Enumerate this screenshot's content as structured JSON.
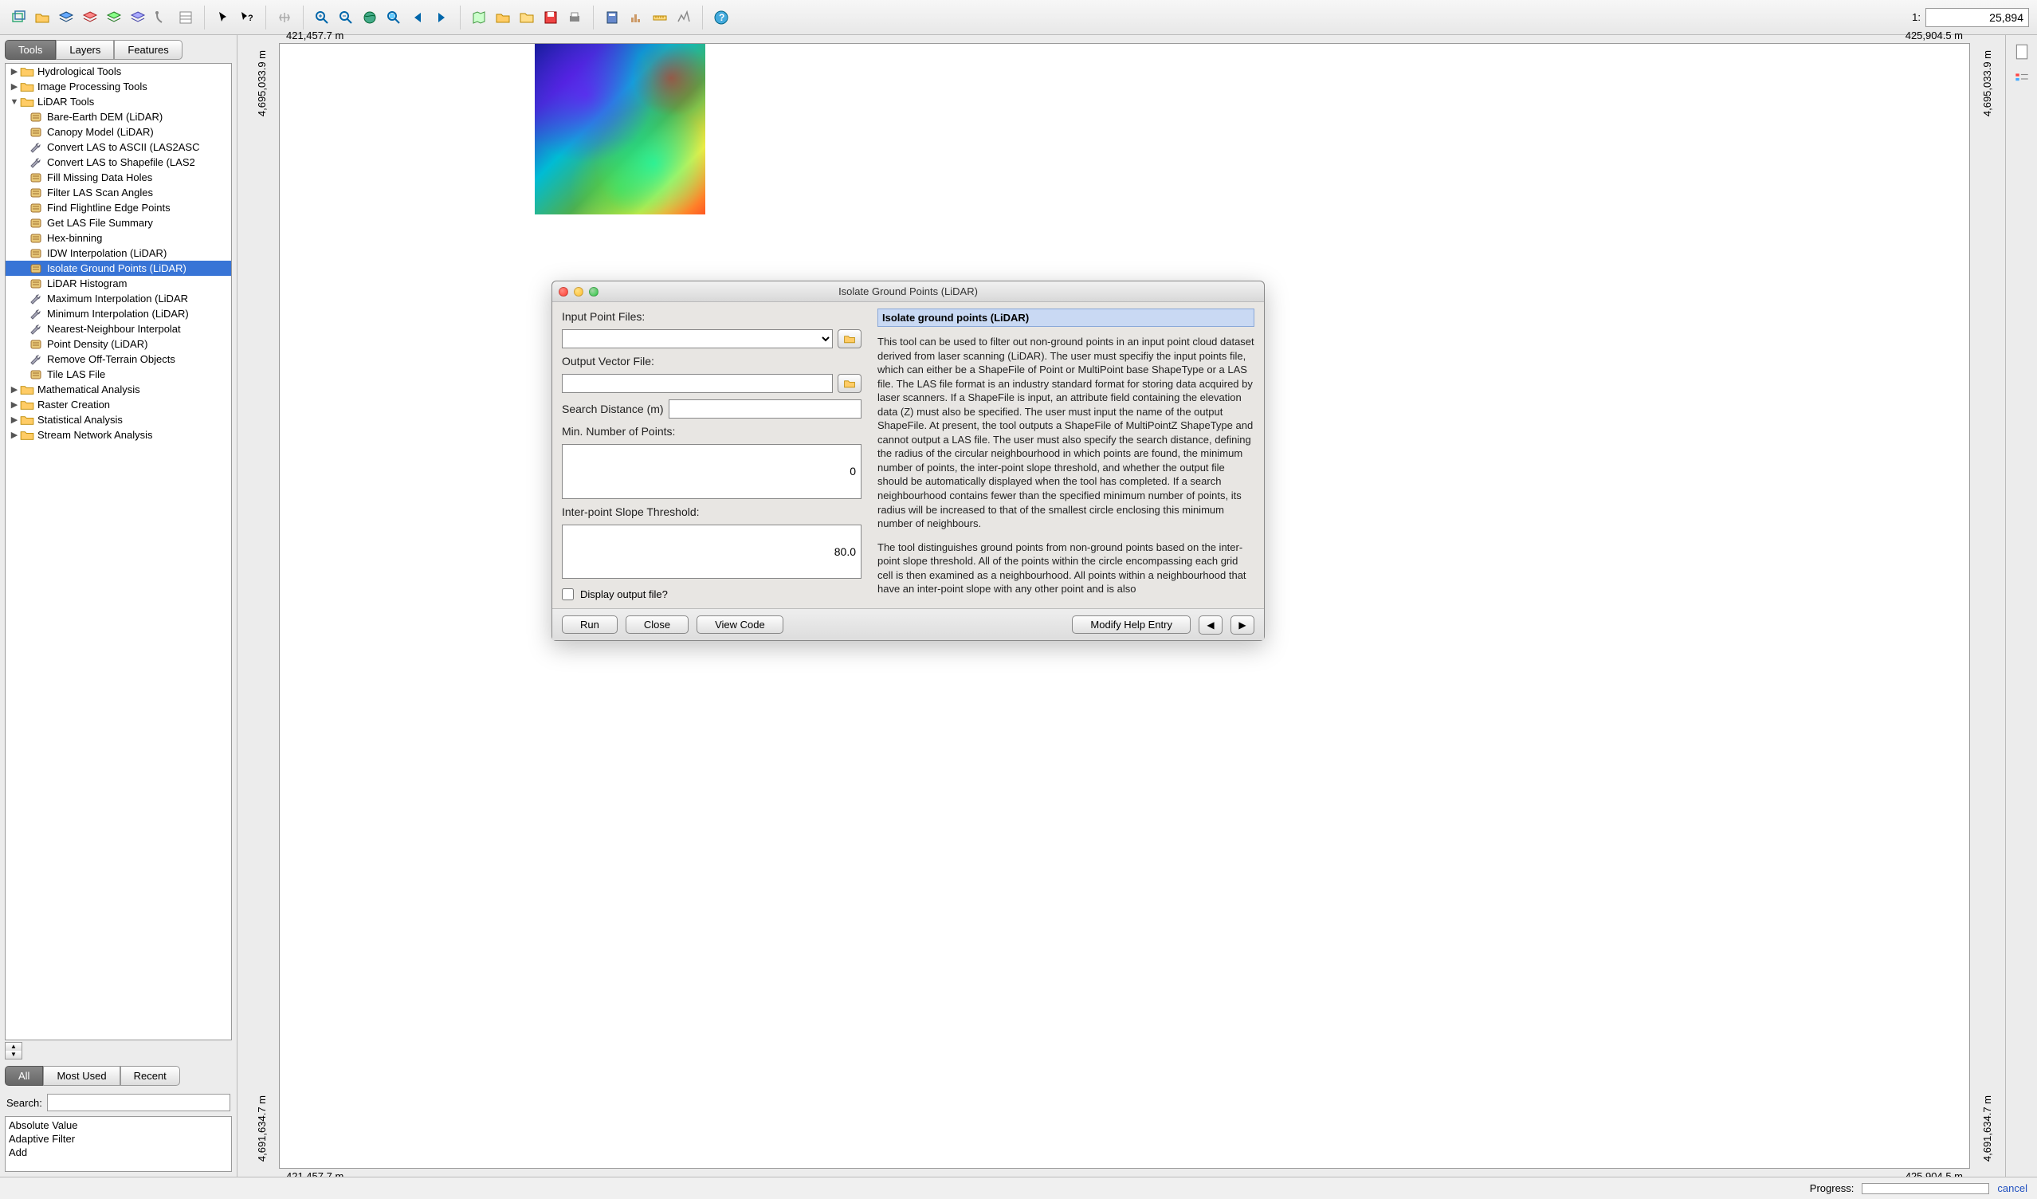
{
  "scale": {
    "prefix": "1:",
    "value": "25,894"
  },
  "sidebar": {
    "tabs": [
      "Tools",
      "Layers",
      "Features"
    ],
    "active_tab": 0,
    "categories": [
      {
        "label": "Hydrological Tools",
        "expanded": false
      },
      {
        "label": "Image Processing Tools",
        "expanded": false
      },
      {
        "label": "LiDAR Tools",
        "expanded": true,
        "items": [
          {
            "label": "Bare-Earth DEM (LiDAR)",
            "icon": "scroll"
          },
          {
            "label": "Canopy Model (LiDAR)",
            "icon": "scroll"
          },
          {
            "label": "Convert LAS to ASCII (LAS2ASC",
            "icon": "wrench"
          },
          {
            "label": "Convert LAS to Shapefile (LAS2",
            "icon": "wrench"
          },
          {
            "label": "Fill Missing Data Holes",
            "icon": "scroll"
          },
          {
            "label": "Filter LAS Scan Angles",
            "icon": "scroll"
          },
          {
            "label": "Find Flightline Edge Points",
            "icon": "scroll"
          },
          {
            "label": "Get LAS File Summary",
            "icon": "scroll"
          },
          {
            "label": "Hex-binning",
            "icon": "scroll"
          },
          {
            "label": "IDW Interpolation (LiDAR)",
            "icon": "scroll"
          },
          {
            "label": "Isolate Ground Points (LiDAR)",
            "icon": "scroll",
            "selected": true
          },
          {
            "label": "LiDAR Histogram",
            "icon": "scroll"
          },
          {
            "label": "Maximum Interpolation (LiDAR",
            "icon": "wrench"
          },
          {
            "label": "Minimum Interpolation (LiDAR)",
            "icon": "wrench"
          },
          {
            "label": "Nearest-Neighbour Interpolat",
            "icon": "wrench"
          },
          {
            "label": "Point Density (LiDAR)",
            "icon": "scroll"
          },
          {
            "label": "Remove Off-Terrain Objects",
            "icon": "wrench"
          },
          {
            "label": "Tile LAS File",
            "icon": "scroll"
          }
        ]
      },
      {
        "label": "Mathematical Analysis",
        "expanded": false
      },
      {
        "label": "Raster Creation",
        "expanded": false
      },
      {
        "label": "Statistical Analysis",
        "expanded": false
      },
      {
        "label": "Stream Network Analysis",
        "expanded": false
      }
    ],
    "filter_tabs": [
      "All",
      "Most Used",
      "Recent"
    ],
    "filter_active": 0,
    "search_label": "Search:",
    "search_value": "",
    "tool_list": [
      "Absolute Value",
      "Adaptive Filter",
      "Add"
    ]
  },
  "map": {
    "x_min": "421,457.7 m",
    "x_max": "425,904.5 m",
    "y_min": "4,691,634.7 m",
    "y_max": "4,695,033.9 m"
  },
  "dialog": {
    "title": "Isolate Ground Points (LiDAR)",
    "labels": {
      "input": "Input Point Files:",
      "output": "Output Vector File:",
      "search_dist": "Search Distance (m)",
      "min_points": "Min. Number of Points:",
      "slope": "Inter-point Slope Threshold:",
      "display": "Display output file?"
    },
    "values": {
      "input": "",
      "output": "",
      "search_dist": "",
      "min_points": "0",
      "slope": "80.0",
      "display_checked": false
    },
    "help": {
      "title": "Isolate ground points (LiDAR)",
      "para1": "This tool can be used to filter out non-ground points in an input point cloud dataset derived from laser scanning (LiDAR). The user must specifiy the input points file, which can either be a ShapeFile of Point or MultiPoint base ShapeType or a LAS file. The LAS file format is an industry standard format for storing data acquired by laser scanners. If a ShapeFile is input, an attribute field containing the elevation data (Z) must also be specified. The user must input the name of the output ShapeFile. At present, the tool outputs a ShapeFile of MultiPointZ ShapeType and cannot output a LAS file. The user must also specify the search distance, defining the radius of the circular neighbourhood in which points are found, the minimum number of points, the inter-point slope threshold, and whether the output file should be automatically displayed when the tool has completed. If a search neighbourhood contains fewer than the specified minimum number of points, its radius will be increased to that of the smallest circle enclosing this minimum number of neighbours.",
      "para2": "The tool distinguishes ground points from non-ground points based on the inter-point slope threshold. All of the points within the circle encompassing each grid cell is then examined as a neighbourhood. All points within a neighbourhood that have an inter-point slope with any other point and is also"
    },
    "buttons": {
      "run": "Run",
      "close": "Close",
      "view_code": "View Code",
      "modify_help": "Modify Help Entry"
    }
  },
  "statusbar": {
    "progress_label": "Progress:",
    "cancel": "cancel"
  }
}
